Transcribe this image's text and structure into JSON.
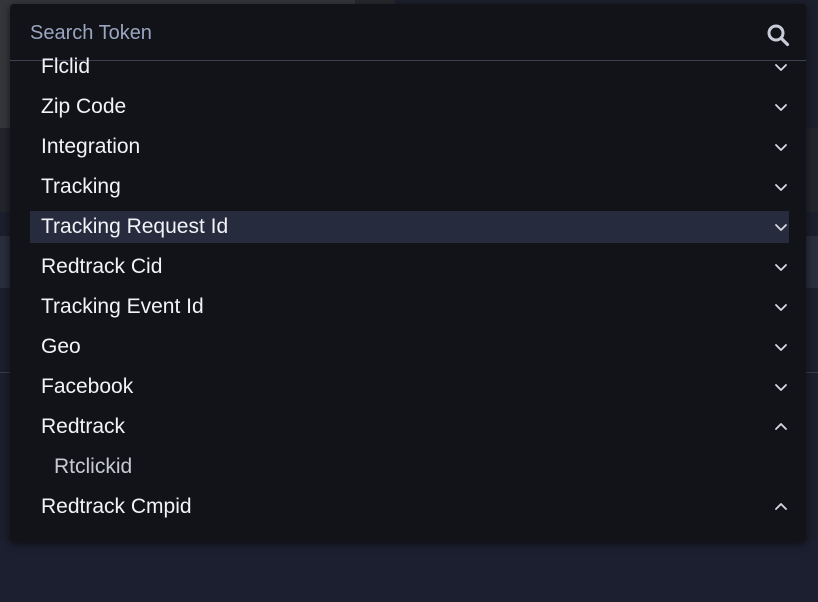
{
  "search": {
    "placeholder": "Search Token",
    "value": ""
  },
  "tokens": [
    {
      "label": "Flclid",
      "expand": "down",
      "active": false,
      "child": false
    },
    {
      "label": "Zip Code",
      "expand": "down",
      "active": false,
      "child": false
    },
    {
      "label": "Integration",
      "expand": "down",
      "active": false,
      "child": false
    },
    {
      "label": "Tracking",
      "expand": "down",
      "active": false,
      "child": false
    },
    {
      "label": "Tracking Request Id",
      "expand": "down",
      "active": true,
      "child": false
    },
    {
      "label": "Redtrack Cid",
      "expand": "down",
      "active": false,
      "child": false
    },
    {
      "label": "Tracking Event Id",
      "expand": "down",
      "active": false,
      "child": false
    },
    {
      "label": "Geo",
      "expand": "down",
      "active": false,
      "child": false
    },
    {
      "label": "Facebook",
      "expand": "down",
      "active": false,
      "child": false
    },
    {
      "label": "Redtrack",
      "expand": "up",
      "active": false,
      "child": false
    },
    {
      "label": "Rtclickid",
      "expand": "none",
      "active": false,
      "child": true
    },
    {
      "label": "Redtrack Cmpid",
      "expand": "up",
      "active": false,
      "child": false
    }
  ],
  "colors": {
    "popup_bg": "#121318",
    "highlight": "#272b3e",
    "text": "#f2f3f6",
    "placeholder": "#9aa6c0"
  }
}
